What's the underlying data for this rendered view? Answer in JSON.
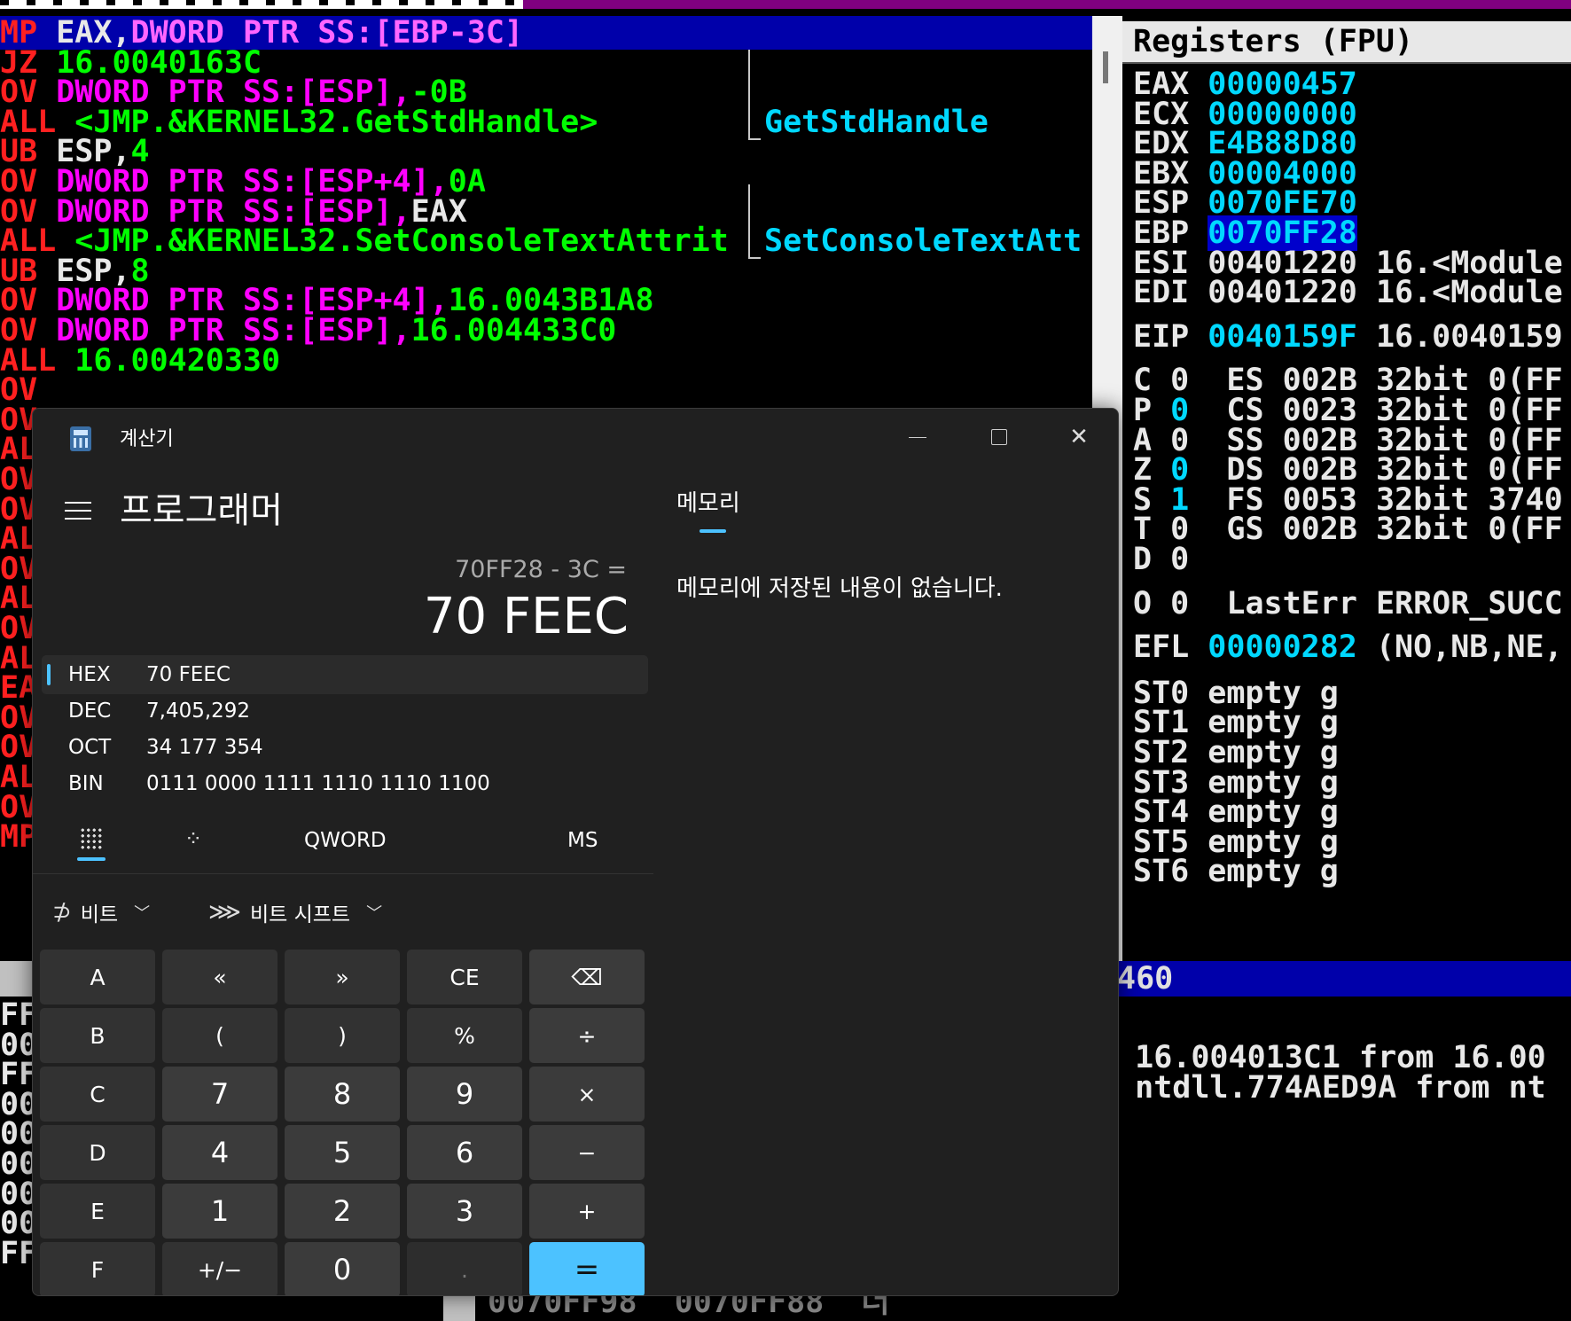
{
  "debugger": {
    "disasm_lines": [
      {
        "mn": "MP",
        "parts": [
          {
            "t": " EAX,",
            "c": "c-w"
          },
          {
            "t": "DWORD PTR SS:[EBP-3C]",
            "c": "c-mw"
          }
        ],
        "selected": true
      },
      {
        "mn": "JZ",
        "parts": [
          {
            "t": " 16.0040163C",
            "c": "c-g"
          }
        ]
      },
      {
        "mn": "OV",
        "parts": [
          {
            "t": " DWORD PTR SS:[ESP],",
            "c": "c-m"
          },
          {
            "t": "-0B",
            "c": "c-g"
          }
        ]
      },
      {
        "mn": "ALL",
        "parts": [
          {
            "t": " <JMP.&KERNEL32.GetStdHandle>",
            "c": "c-g"
          }
        ]
      },
      {
        "mn": "UB",
        "parts": [
          {
            "t": " ESP,",
            "c": "c-w"
          },
          {
            "t": "4",
            "c": "c-g"
          }
        ]
      },
      {
        "mn": "OV",
        "parts": [
          {
            "t": " DWORD PTR SS:[ESP+4],",
            "c": "c-m"
          },
          {
            "t": "0A",
            "c": "c-g"
          }
        ]
      },
      {
        "mn": "OV",
        "parts": [
          {
            "t": " DWORD PTR SS:[ESP],",
            "c": "c-m"
          },
          {
            "t": "EAX",
            "c": "c-w"
          }
        ]
      },
      {
        "mn": "ALL",
        "parts": [
          {
            "t": " <JMP.&KERNEL32.SetConsoleTextAttrit",
            "c": "c-g"
          }
        ]
      },
      {
        "mn": "UB",
        "parts": [
          {
            "t": " ESP,",
            "c": "c-w"
          },
          {
            "t": "8",
            "c": "c-g"
          }
        ]
      },
      {
        "mn": "OV",
        "parts": [
          {
            "t": " DWORD PTR SS:[ESP+4],",
            "c": "c-m"
          },
          {
            "t": "16.0043B1A8",
            "c": "c-g"
          }
        ]
      },
      {
        "mn": "OV",
        "parts": [
          {
            "t": " DWORD PTR SS:[ESP],",
            "c": "c-m"
          },
          {
            "t": "16.004433C0",
            "c": "c-g"
          }
        ]
      },
      {
        "mn": "ALL",
        "parts": [
          {
            "t": " 16.00420330",
            "c": "c-g"
          }
        ]
      },
      {
        "mn": "OV",
        "parts": []
      },
      {
        "mn": "OV",
        "parts": []
      },
      {
        "mn": "ALL",
        "parts": []
      },
      {
        "mn": "OV",
        "parts": []
      },
      {
        "mn": "OV",
        "parts": []
      },
      {
        "mn": "ALL",
        "parts": []
      },
      {
        "mn": "OV",
        "parts": []
      },
      {
        "mn": "ALL",
        "parts": []
      },
      {
        "mn": "OV",
        "parts": []
      },
      {
        "mn": "ALL",
        "parts": []
      },
      {
        "mn": "EA",
        "parts": []
      },
      {
        "mn": "OV",
        "parts": []
      },
      {
        "mn": "OV",
        "parts": []
      },
      {
        "mn": "ALL",
        "parts": []
      },
      {
        "mn": "OV",
        "parts": []
      },
      {
        "mn": "MP",
        "parts": []
      }
    ],
    "comments": [
      "GetStdHandle",
      "SetConsoleTextAtt"
    ],
    "registers_title": "Registers (FPU)",
    "registers": [
      {
        "name": "EAX",
        "value": "00000457",
        "extra": ""
      },
      {
        "name": "ECX",
        "value": "00000000",
        "extra": ""
      },
      {
        "name": "EDX",
        "value": "E4B88D80",
        "extra": ""
      },
      {
        "name": "EBX",
        "value": "00004000",
        "extra": ""
      },
      {
        "name": "ESP",
        "value": "0070FE70",
        "extra": ""
      },
      {
        "name": "EBP",
        "value": "0070FF28",
        "extra": "",
        "highlight": true
      },
      {
        "name": "ESI",
        "value": "00401220",
        "extra": "16.<Module",
        "white": true
      },
      {
        "name": "EDI",
        "value": "00401220",
        "extra": "16.<Module",
        "white": true
      },
      {
        "name": "EIP",
        "value": "0040159F",
        "extra": "16.0040159",
        "gap": true
      }
    ],
    "flags": [
      {
        "f": "C",
        "v": "0",
        "seg": "ES 002B 32bit 0(FF"
      },
      {
        "f": "P",
        "v": "0",
        "seg": "CS 0023 32bit 0(FF",
        "cyan": true
      },
      {
        "f": "A",
        "v": "0",
        "seg": "SS 002B 32bit 0(FF"
      },
      {
        "f": "Z",
        "v": "0",
        "seg": "DS 002B 32bit 0(FF",
        "cyan": true
      },
      {
        "f": "S",
        "v": "1",
        "seg": "FS 0053 32bit 3740",
        "cyan": true
      },
      {
        "f": "T",
        "v": "0",
        "seg": "GS 002B 32bit 0(FF"
      },
      {
        "f": "D",
        "v": "0",
        "seg": ""
      },
      {
        "f": "O",
        "v": "0",
        "seg": "LastErr ERROR_SUCC"
      }
    ],
    "efl": {
      "name": "EFL",
      "value": "00000282",
      "extra": "(NO,NB,NE,"
    },
    "fpu": [
      "ST0 empty g",
      "ST1 empty g",
      "ST2 empty g",
      "ST3 empty g",
      "ST4 empty g",
      "ST5 empty g",
      "ST6 empty g"
    ],
    "split_bar_text": "460",
    "stack_lines": [
      "o 16.004013C1 from 16.00",
      "o ntdll.774AED9A from nt"
    ],
    "dump_left": [
      "FF",
      "00",
      "FF",
      "00",
      "00",
      "00",
      "00",
      "00",
      "FF"
    ],
    "bottom_text": "0070FF98  0070FF88  더"
  },
  "calculator": {
    "title": "계산기",
    "mode": "프로그래머",
    "expression": "70FF28 - 3C =",
    "result": "70 FEEC",
    "bases": [
      {
        "label": "HEX",
        "value": "70 FEEC",
        "active": true
      },
      {
        "label": "DEC",
        "value": "7,405,292"
      },
      {
        "label": "OCT",
        "value": "34 177 354"
      },
      {
        "label": "BIN",
        "value": "0111 0000 1111 1110 1110 1100"
      }
    ],
    "word_size": "QWORD",
    "ms_label": "MS",
    "bitwise_label": "비트",
    "bitshift_label": "비트 시프트",
    "keys": [
      [
        "A",
        "«",
        "»",
        "CE",
        "⌫"
      ],
      [
        "B",
        "(",
        ")",
        "%",
        "÷"
      ],
      [
        "C",
        "7",
        "8",
        "9",
        "×"
      ],
      [
        "D",
        "4",
        "5",
        "6",
        "−"
      ],
      [
        "E",
        "1",
        "2",
        "3",
        "+"
      ],
      [
        "F",
        "+/−",
        "0",
        ".",
        "="
      ]
    ],
    "memory_tab": "메모리",
    "memory_empty": "메모리에 저장된 내용이 없습니다."
  }
}
